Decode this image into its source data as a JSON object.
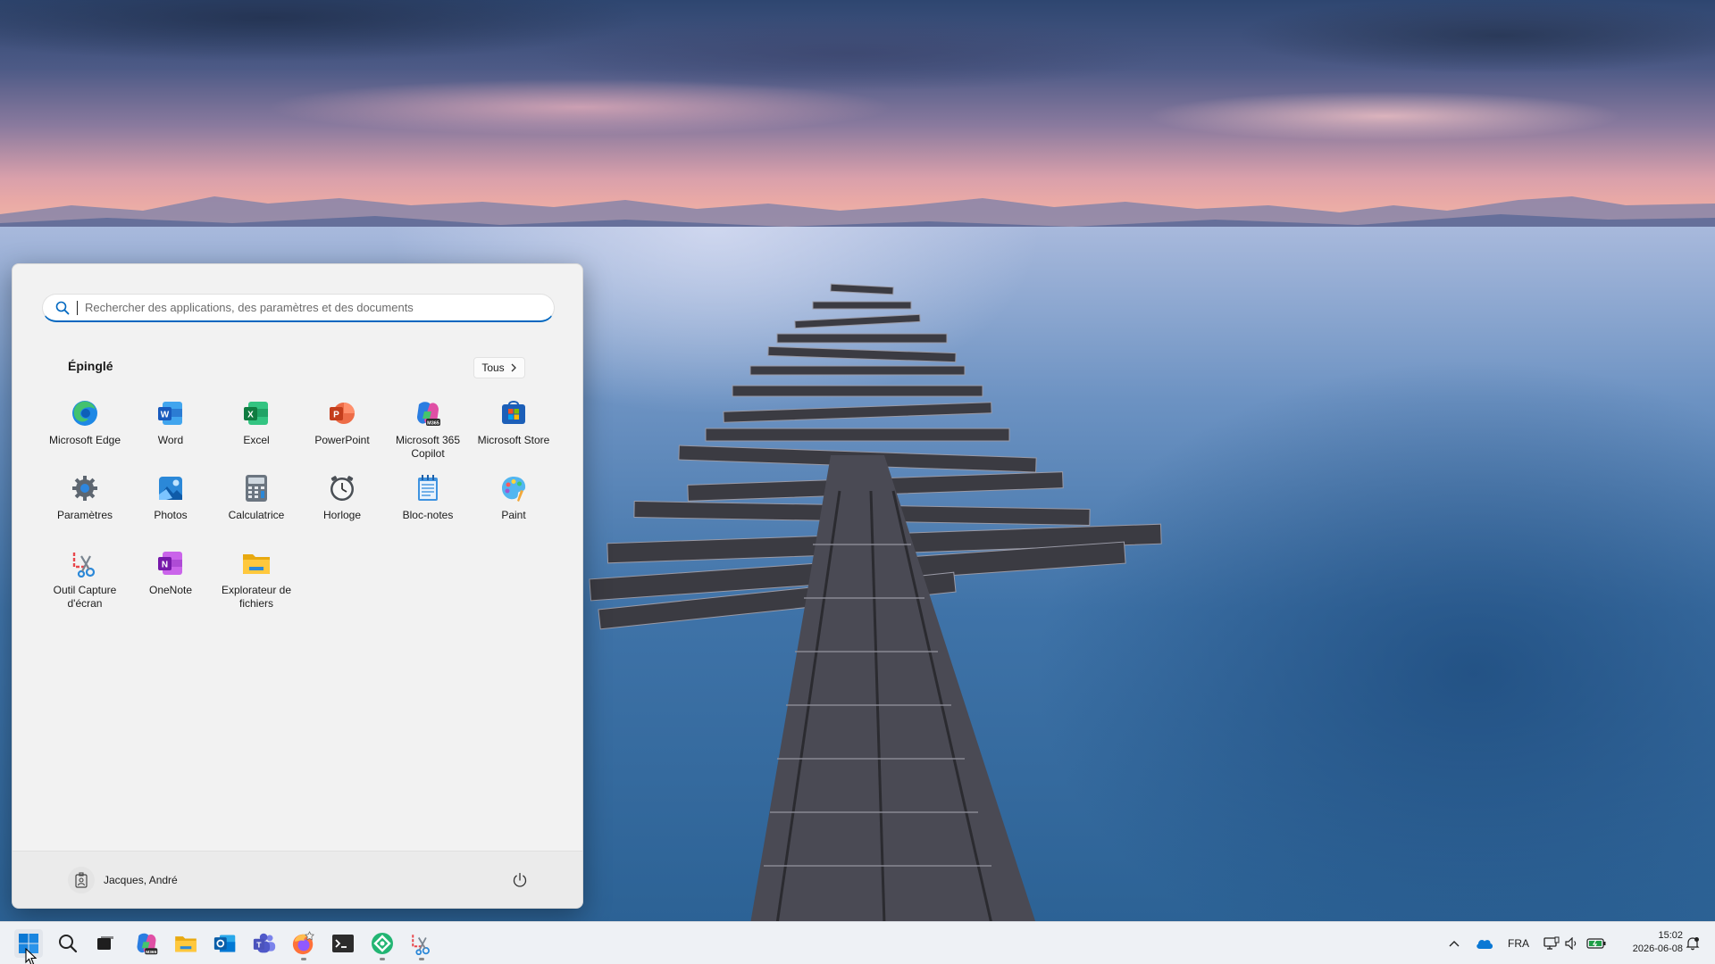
{
  "start_menu": {
    "search_placeholder": "Rechercher des applications, des paramètres et des documents",
    "pinned_title": "Épinglé",
    "all_button": "Tous",
    "apps": [
      {
        "label": "Microsoft Edge",
        "icon": "edge-icon"
      },
      {
        "label": "Word",
        "icon": "word-icon"
      },
      {
        "label": "Excel",
        "icon": "excel-icon"
      },
      {
        "label": "PowerPoint",
        "icon": "powerpoint-icon"
      },
      {
        "label": "Microsoft 365 Copilot",
        "icon": "m365-copilot-icon"
      },
      {
        "label": "Microsoft Store",
        "icon": "store-icon"
      },
      {
        "label": "Paramètres",
        "icon": "settings-gear-icon"
      },
      {
        "label": "Photos",
        "icon": "photos-icon"
      },
      {
        "label": "Calculatrice",
        "icon": "calculator-icon"
      },
      {
        "label": "Horloge",
        "icon": "clock-icon"
      },
      {
        "label": "Bloc-notes",
        "icon": "notepad-icon"
      },
      {
        "label": "Paint",
        "icon": "paint-icon"
      },
      {
        "label": "Outil Capture d'écran",
        "icon": "snipping-tool-icon"
      },
      {
        "label": "OneNote",
        "icon": "onenote-icon"
      },
      {
        "label": "Explorateur de fichiers",
        "icon": "file-explorer-icon"
      }
    ],
    "user_name": "Jacques, André"
  },
  "taskbar": {
    "items": [
      "start-icon",
      "search-icon",
      "task-view-icon",
      "m365-copilot-icon",
      "file-explorer-icon",
      "outlook-icon",
      "teams-icon",
      "firefox-icon",
      "terminal-icon",
      "green-app-icon",
      "snipping-tool-icon"
    ],
    "language": "FRA",
    "time": "15:02",
    "date": "2026-06-08"
  },
  "colors": {
    "accent": "#0067c0",
    "menu_bg": "#f2f2f2",
    "taskbar_bg": "#eef1f5"
  }
}
